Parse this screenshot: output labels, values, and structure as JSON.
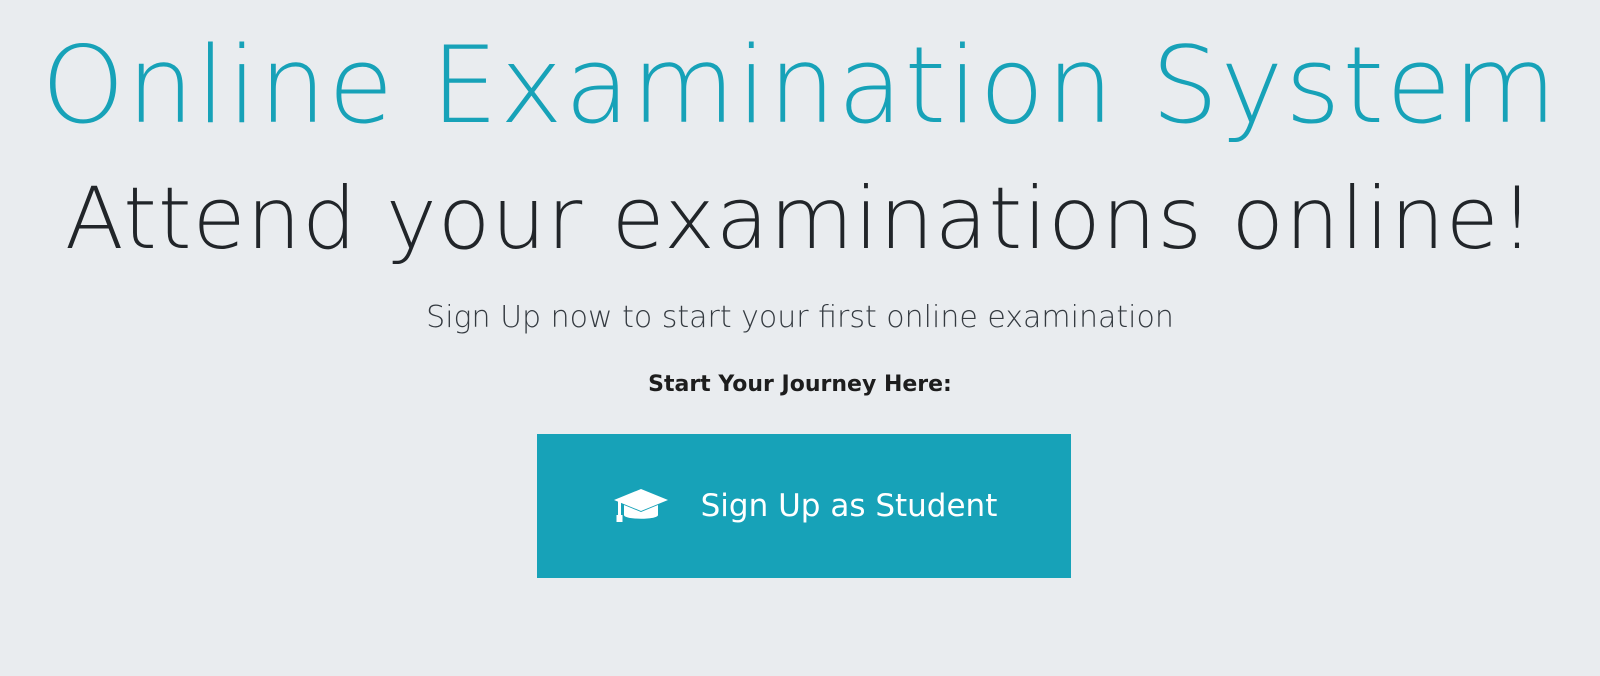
{
  "hero": {
    "title": "Online Examination System",
    "subtitle": "Attend your examinations online!",
    "lead": "Sign Up now to start your first online examination",
    "journey_label": "Start Your Journey Here:"
  },
  "cta": {
    "label": "Sign Up as Student",
    "icon": "graduation-cap-icon",
    "color": "#17a2b8",
    "text_color": "#ffffff"
  },
  "theme": {
    "background": "#e9ecef",
    "accent": "#17a2b8",
    "text": "#212529"
  }
}
